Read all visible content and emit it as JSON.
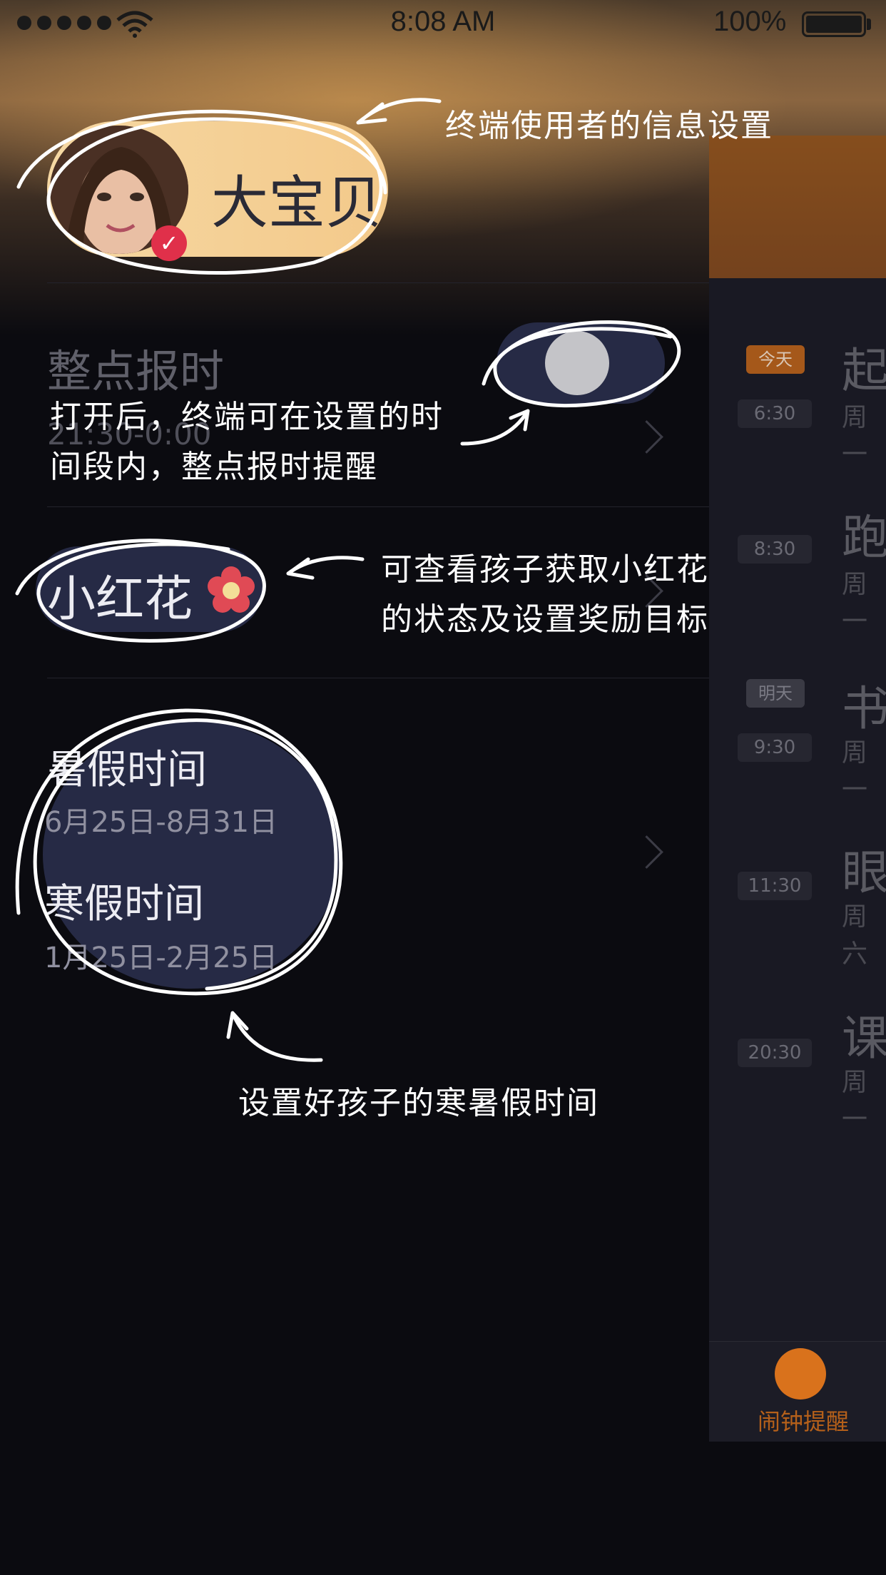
{
  "status_bar": {
    "time": "8:08 AM",
    "battery": "100%"
  },
  "profile": {
    "name": "大宝贝"
  },
  "annotations": {
    "profile_note": "终端使用者的信息设置",
    "chime_note_line1": "打开后，终端可在设置的时",
    "chime_note_line2": "间段内，整点报时提醒",
    "flower_note_line1": "可查看孩子获取小红花",
    "flower_note_line2": "的状态及设置奖励目标",
    "holiday_note": "设置好孩子的寒暑假时间"
  },
  "menu": {
    "hourly_chime": {
      "title": "整点报时",
      "subtitle": "21:30-0:00",
      "enabled": true
    },
    "red_flower": {
      "title": "小红花"
    },
    "holidays": {
      "summer_title": "暑假时间",
      "summer_range": "6月25日-8月31日",
      "winter_title": "寒假时间",
      "winter_range": "1月25日-2月25日"
    }
  },
  "right_panel": {
    "items": [
      {
        "badge": "今天",
        "time": "6:30",
        "title": "起",
        "sub": "周一"
      },
      {
        "badge": "",
        "time": "8:30",
        "title": "跑",
        "sub": "周一"
      },
      {
        "badge": "明天",
        "time": "9:30",
        "title": "书",
        "sub": "周一"
      },
      {
        "badge": "",
        "time": "11:30",
        "title": "眼",
        "sub": "周六"
      },
      {
        "badge": "",
        "time": "20:30",
        "title": "课",
        "sub": "周一"
      }
    ],
    "tab_label": "闹钟提醒"
  },
  "colors": {
    "accent_orange": "#d9721c",
    "pill_navy": "#262a45",
    "background": "#0b0b10"
  }
}
